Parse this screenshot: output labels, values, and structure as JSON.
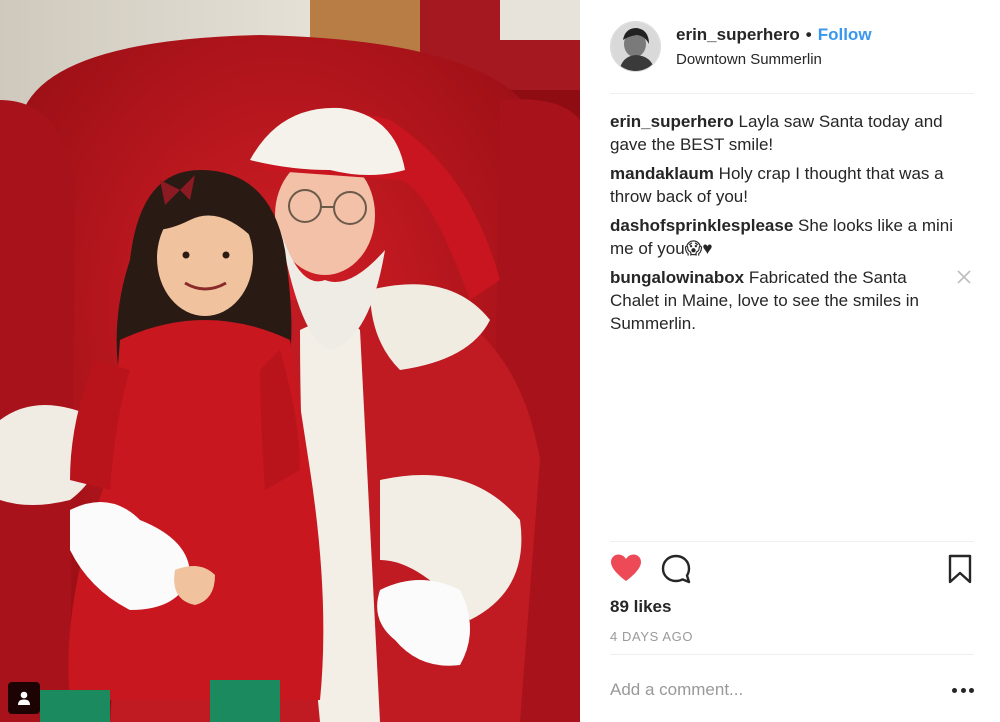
{
  "post": {
    "username": "erin_superhero",
    "follow_separator": "•",
    "follow_label": "Follow",
    "location": "Downtown Summerlin"
  },
  "comments": [
    {
      "author": "erin_superhero",
      "text": "Layla saw Santa today and gave the BEST smile!"
    },
    {
      "author": "mandaklaum",
      "text": "Holy crap I thought that was a throw back of you!"
    },
    {
      "author": "dashofsprinklesplease",
      "text": "She looks like a mini me of you😱♥"
    },
    {
      "author": "bungalowinabox",
      "text": "Fabricated the Santa Chalet in Maine, love to see the smiles in Summerlin."
    }
  ],
  "stats": {
    "likes": "89 likes",
    "timestamp": "4 DAYS AGO"
  },
  "composer": {
    "placeholder": "Add a comment..."
  },
  "icons": {
    "like": "heart-icon",
    "comment": "speech-bubble-icon",
    "save": "bookmark-icon",
    "more": "ellipsis-icon",
    "tagged": "person-icon",
    "remove": "close-icon"
  },
  "colors": {
    "follow": "#3897f0",
    "liked_heart": "#ed4956",
    "text": "#262626",
    "muted": "#999999"
  }
}
